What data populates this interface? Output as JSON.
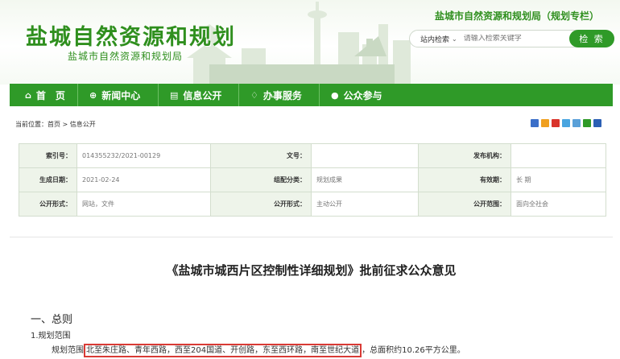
{
  "header": {
    "logo_main": "盐城自然资源和规划",
    "logo_sub": "盐城市自然资源和规划局",
    "site_name": "盐城市自然资源和规划局（规划专栏）",
    "search": {
      "scope": "站内检索",
      "placeholder": "请输入检索关键字",
      "button": "检 索"
    }
  },
  "nav": [
    {
      "icon": "home-icon",
      "label": "首　页"
    },
    {
      "icon": "globe-icon",
      "label": "新闻中心"
    },
    {
      "icon": "document-icon",
      "label": "信息公开"
    },
    {
      "icon": "thumbs-up-icon",
      "label": "办事服务"
    },
    {
      "icon": "user-icon",
      "label": "公众参与"
    }
  ],
  "breadcrumb": "当前位置：首页 > 信息公开",
  "meta": {
    "index_no_label": "索引号：",
    "index_no": "014355232/2021-00129",
    "doc_no_label": "文号：",
    "doc_no": "",
    "publisher_label": "发布机构：",
    "publisher": "",
    "created_label": "生成日期：",
    "created": "2021-02-24",
    "category_label": "组配分类：",
    "category": "规划成果",
    "validity_label": "有效期：",
    "validity": "长 期",
    "form_label": "公开形式：",
    "form": "网站，文件",
    "form2_label": "公开形式：",
    "form2": "主动公开",
    "scope_label": "公开范围：",
    "scope": "面向全社会"
  },
  "article": {
    "title": "《盐城市城西片区控制性详细规划》批前征求公众意见",
    "section": "一、总则",
    "subsection": "1.规划范围",
    "para_prefix": "规划范围",
    "para_highlight": "北至朱庄路、青年西路，西至204国道、开创路，东至西环路，南至世纪大道",
    "para_suffix": "，总面积约10.26平方公里。"
  },
  "colors": {
    "brand_green": "#2f9a28",
    "highlight_red": "#d93a35"
  }
}
